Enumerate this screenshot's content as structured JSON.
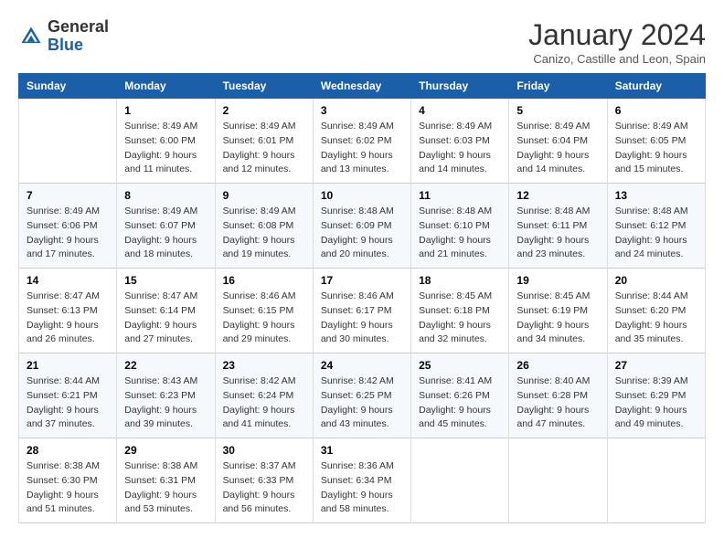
{
  "header": {
    "logo_line1": "General",
    "logo_line2": "Blue",
    "month": "January 2024",
    "location": "Canizo, Castille and Leon, Spain"
  },
  "days_of_week": [
    "Sunday",
    "Monday",
    "Tuesday",
    "Wednesday",
    "Thursday",
    "Friday",
    "Saturday"
  ],
  "weeks": [
    [
      {
        "day": "",
        "info": ""
      },
      {
        "day": "1",
        "info": "Sunrise: 8:49 AM\nSunset: 6:00 PM\nDaylight: 9 hours\nand 11 minutes."
      },
      {
        "day": "2",
        "info": "Sunrise: 8:49 AM\nSunset: 6:01 PM\nDaylight: 9 hours\nand 12 minutes."
      },
      {
        "day": "3",
        "info": "Sunrise: 8:49 AM\nSunset: 6:02 PM\nDaylight: 9 hours\nand 13 minutes."
      },
      {
        "day": "4",
        "info": "Sunrise: 8:49 AM\nSunset: 6:03 PM\nDaylight: 9 hours\nand 14 minutes."
      },
      {
        "day": "5",
        "info": "Sunrise: 8:49 AM\nSunset: 6:04 PM\nDaylight: 9 hours\nand 14 minutes."
      },
      {
        "day": "6",
        "info": "Sunrise: 8:49 AM\nSunset: 6:05 PM\nDaylight: 9 hours\nand 15 minutes."
      }
    ],
    [
      {
        "day": "7",
        "info": "Sunrise: 8:49 AM\nSunset: 6:06 PM\nDaylight: 9 hours\nand 17 minutes."
      },
      {
        "day": "8",
        "info": "Sunrise: 8:49 AM\nSunset: 6:07 PM\nDaylight: 9 hours\nand 18 minutes."
      },
      {
        "day": "9",
        "info": "Sunrise: 8:49 AM\nSunset: 6:08 PM\nDaylight: 9 hours\nand 19 minutes."
      },
      {
        "day": "10",
        "info": "Sunrise: 8:48 AM\nSunset: 6:09 PM\nDaylight: 9 hours\nand 20 minutes."
      },
      {
        "day": "11",
        "info": "Sunrise: 8:48 AM\nSunset: 6:10 PM\nDaylight: 9 hours\nand 21 minutes."
      },
      {
        "day": "12",
        "info": "Sunrise: 8:48 AM\nSunset: 6:11 PM\nDaylight: 9 hours\nand 23 minutes."
      },
      {
        "day": "13",
        "info": "Sunrise: 8:48 AM\nSunset: 6:12 PM\nDaylight: 9 hours\nand 24 minutes."
      }
    ],
    [
      {
        "day": "14",
        "info": "Sunrise: 8:47 AM\nSunset: 6:13 PM\nDaylight: 9 hours\nand 26 minutes."
      },
      {
        "day": "15",
        "info": "Sunrise: 8:47 AM\nSunset: 6:14 PM\nDaylight: 9 hours\nand 27 minutes."
      },
      {
        "day": "16",
        "info": "Sunrise: 8:46 AM\nSunset: 6:15 PM\nDaylight: 9 hours\nand 29 minutes."
      },
      {
        "day": "17",
        "info": "Sunrise: 8:46 AM\nSunset: 6:17 PM\nDaylight: 9 hours\nand 30 minutes."
      },
      {
        "day": "18",
        "info": "Sunrise: 8:45 AM\nSunset: 6:18 PM\nDaylight: 9 hours\nand 32 minutes."
      },
      {
        "day": "19",
        "info": "Sunrise: 8:45 AM\nSunset: 6:19 PM\nDaylight: 9 hours\nand 34 minutes."
      },
      {
        "day": "20",
        "info": "Sunrise: 8:44 AM\nSunset: 6:20 PM\nDaylight: 9 hours\nand 35 minutes."
      }
    ],
    [
      {
        "day": "21",
        "info": "Sunrise: 8:44 AM\nSunset: 6:21 PM\nDaylight: 9 hours\nand 37 minutes."
      },
      {
        "day": "22",
        "info": "Sunrise: 8:43 AM\nSunset: 6:23 PM\nDaylight: 9 hours\nand 39 minutes."
      },
      {
        "day": "23",
        "info": "Sunrise: 8:42 AM\nSunset: 6:24 PM\nDaylight: 9 hours\nand 41 minutes."
      },
      {
        "day": "24",
        "info": "Sunrise: 8:42 AM\nSunset: 6:25 PM\nDaylight: 9 hours\nand 43 minutes."
      },
      {
        "day": "25",
        "info": "Sunrise: 8:41 AM\nSunset: 6:26 PM\nDaylight: 9 hours\nand 45 minutes."
      },
      {
        "day": "26",
        "info": "Sunrise: 8:40 AM\nSunset: 6:28 PM\nDaylight: 9 hours\nand 47 minutes."
      },
      {
        "day": "27",
        "info": "Sunrise: 8:39 AM\nSunset: 6:29 PM\nDaylight: 9 hours\nand 49 minutes."
      }
    ],
    [
      {
        "day": "28",
        "info": "Sunrise: 8:38 AM\nSunset: 6:30 PM\nDaylight: 9 hours\nand 51 minutes."
      },
      {
        "day": "29",
        "info": "Sunrise: 8:38 AM\nSunset: 6:31 PM\nDaylight: 9 hours\nand 53 minutes."
      },
      {
        "day": "30",
        "info": "Sunrise: 8:37 AM\nSunset: 6:33 PM\nDaylight: 9 hours\nand 56 minutes."
      },
      {
        "day": "31",
        "info": "Sunrise: 8:36 AM\nSunset: 6:34 PM\nDaylight: 9 hours\nand 58 minutes."
      },
      {
        "day": "",
        "info": ""
      },
      {
        "day": "",
        "info": ""
      },
      {
        "day": "",
        "info": ""
      }
    ]
  ]
}
